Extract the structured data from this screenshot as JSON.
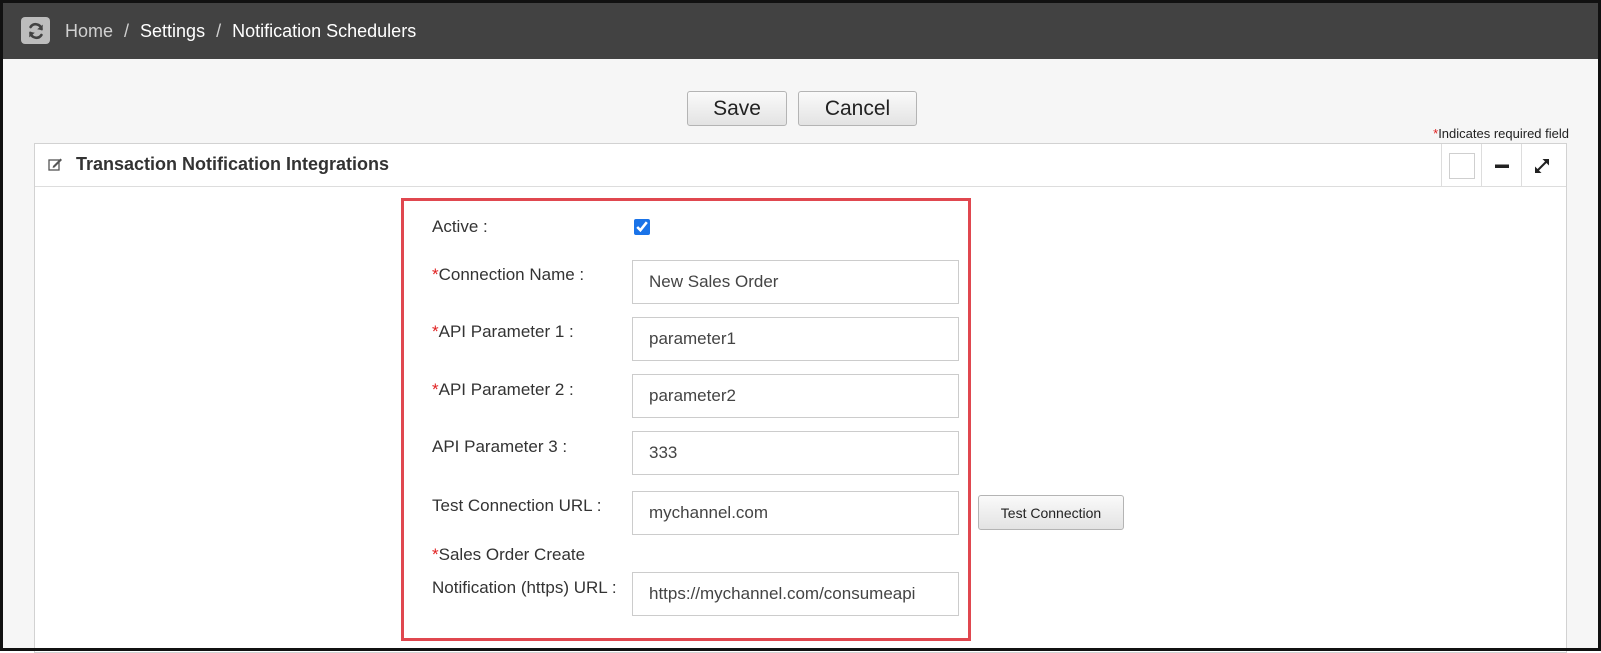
{
  "breadcrumb": {
    "items": [
      "Home",
      "Settings",
      "Notification Schedulers"
    ],
    "separator": "/"
  },
  "toolbar": {
    "save_label": "Save",
    "cancel_label": "Cancel"
  },
  "required_note": {
    "marker": "*",
    "text": "Indicates required field"
  },
  "panel": {
    "title": "Transaction Notification Integrations"
  },
  "form": {
    "required_marker": "*",
    "active": {
      "label": "Active :",
      "checked": true
    },
    "connection_name": {
      "label": "Connection Name :",
      "value": "New Sales Order",
      "required": true
    },
    "api_param_1": {
      "label": "API Parameter 1 :",
      "value": "parameter1",
      "required": true
    },
    "api_param_2": {
      "label": "API Parameter 2 :",
      "value": "parameter2",
      "required": true
    },
    "api_param_3": {
      "label": "API Parameter 3 :",
      "value": "333",
      "required": false
    },
    "test_url": {
      "label": "Test Connection URL :",
      "value": "mychannel.com",
      "required": false,
      "button_label": "Test Connection"
    },
    "so_create_url": {
      "label": "Sales Order Create Notification (https) URL :",
      "value": "https://mychannel.com/consumeapi",
      "required": true
    }
  },
  "icons": {
    "refresh": "refresh-icon",
    "edit": "edit-icon",
    "minimize": "minimize-icon",
    "expand": "expand-icon"
  },
  "colors": {
    "topbar": "#424242",
    "highlight": "#e0474f",
    "required": "#e02020",
    "checkbox": "#1a73e8"
  }
}
